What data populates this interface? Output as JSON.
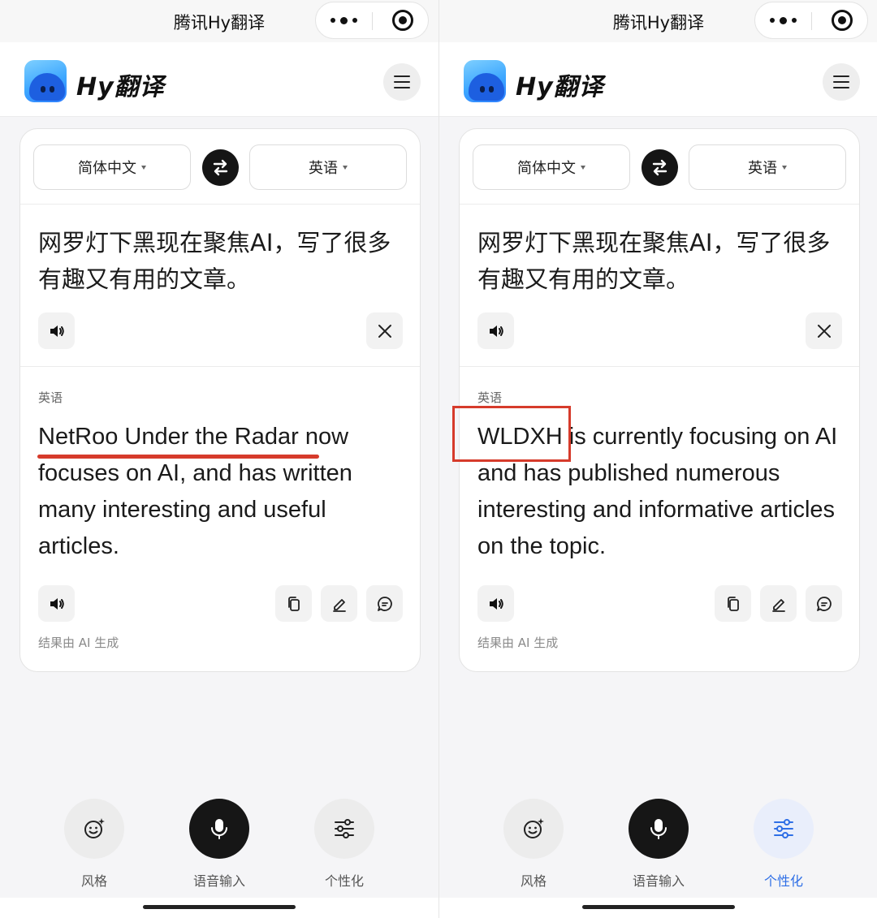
{
  "mini_program": {
    "title": "腾讯Hy翻译"
  },
  "app": {
    "brand": "Hy翻译"
  },
  "language": {
    "source": "简体中文",
    "target": "英语"
  },
  "source_text": "网罗灯下黑现在聚焦AI，写了很多有趣又有用的文章。",
  "target_label": "英语",
  "ai_note": "结果由 AI 生成",
  "panels": [
    {
      "result_text": "NetRoo Under the Radar now focuses on AI, and has written many interesting and useful articles.",
      "highlight_style": "underline",
      "active_tool": ""
    },
    {
      "result_text": "WLDXH is currently focusing on AI and has published numerous interesting and informative articles on the topic.",
      "highlight_style": "box",
      "active_tool": "personalize"
    }
  ],
  "toolbar": {
    "style_label": "风格",
    "voice_label": "语音输入",
    "personalize_label": "个性化"
  },
  "colors": {
    "accent_blue": "#2f6fe6",
    "annotation_red": "#d63b2b",
    "dark_button": "#161616"
  },
  "icons": [
    "more-dots-icon",
    "target-icon",
    "menu-icon",
    "swap-icon",
    "speaker-icon",
    "close-icon",
    "copy-icon",
    "edit-icon",
    "feedback-icon",
    "smile-sparkle-icon",
    "microphone-icon",
    "sliders-icon"
  ]
}
